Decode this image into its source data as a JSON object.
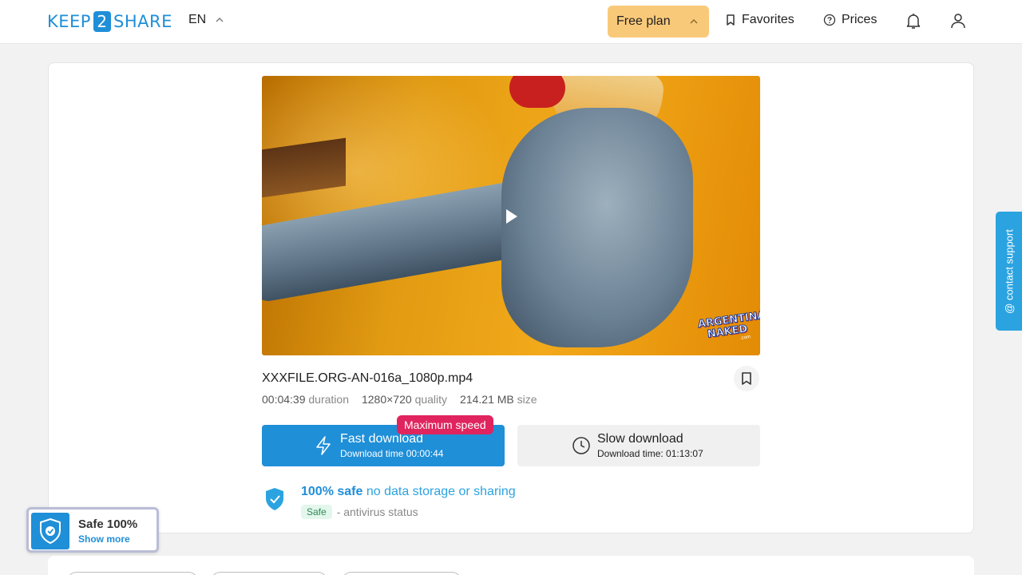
{
  "header": {
    "logo_prefix": "KEEP",
    "logo_number": "2",
    "logo_suffix": "SHARE",
    "language": "EN",
    "plan_label": "Free plan",
    "favorites_label": "Favorites",
    "prices_label": "Prices"
  },
  "file": {
    "name": "XXXFILE.ORG-AN-016a_1080p.mp4",
    "duration_value": "00:04:39",
    "duration_label": "duration",
    "quality_value": "1280×720",
    "quality_label": "quality",
    "size_value": "214.21 MB",
    "size_label": "size",
    "watermark_line1": "ARGENTINA",
    "watermark_line2": "NAKED",
    "watermark_line3": ".com"
  },
  "download": {
    "badge": "Maximum speed",
    "fast_title": "Fast download",
    "fast_time": "Download time 00:00:44",
    "slow_title": "Slow download",
    "slow_time": "Download time: 01:13:07"
  },
  "safety": {
    "title_strong": "100% safe",
    "title_rest": "no data storage or sharing",
    "status_pill": "Safe",
    "status_text": "- antivirus status"
  },
  "support": {
    "label": "@ contact support"
  },
  "safe_widget": {
    "title": "Safe 100%",
    "link": "Show more"
  },
  "colors": {
    "brand": "#1f8fd8",
    "plan_bg": "#f9c97a",
    "badge_red": "#e0245e",
    "safe_green": "#2e8a55"
  },
  "icons": {
    "language": "chevron-up-icon",
    "plan": "chevron-up-icon",
    "favorites": "bookmark-icon",
    "prices": "question-circle-icon",
    "notifications": "bell-icon",
    "account": "user-icon",
    "play": "play-icon",
    "fast": "lightning-icon",
    "slow": "clock-icon",
    "safe": "shield-check-icon"
  }
}
